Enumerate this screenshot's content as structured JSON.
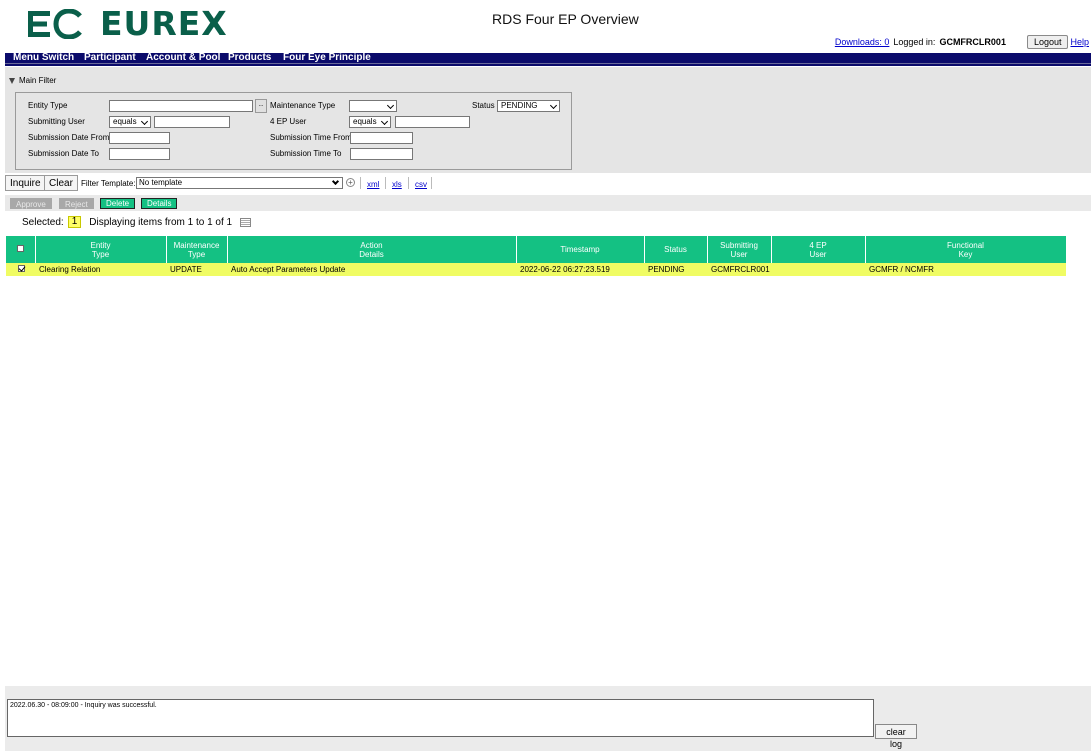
{
  "brand": {
    "logo_text": "EUREX",
    "logo_mark": "EC"
  },
  "app_title": "RDS Four EP Overview",
  "user": {
    "downloads_label": "Downloads: 0",
    "logged_in_label": "Logged in:",
    "username": "GCMFRCLR001",
    "logout_label": "Logout",
    "help_label": "Help"
  },
  "menu": [
    "Menu Switch",
    "Participant",
    "Account & Pool",
    "Products",
    "Four Eye Principle"
  ],
  "filter": {
    "section_label": "Main Filter",
    "entity_type_label": "Entity Type",
    "entity_type_value": "",
    "lookup_label": "..",
    "maintenance_type_label": "Maintenance Type",
    "maintenance_type_value": "",
    "status_label": "Status",
    "status_value": "PENDING",
    "submitting_user_label": "Submitting User",
    "submitting_user_op": "equals",
    "submitting_user_value": "",
    "four_ep_user_label": "4 EP User",
    "four_ep_user_op": "equals",
    "four_ep_user_value": "",
    "submission_date_from_label": "Submission Date From",
    "submission_date_to_label": "Submission Date To",
    "submission_time_from_label": "Submission Time From",
    "submission_time_to_label": "Submission Time To"
  },
  "toolbar": {
    "inquire_label": "Inquire",
    "clear_label": "Clear",
    "filter_template_label": "Filter Template:",
    "filter_template_value": "No template",
    "export": [
      "xml",
      "xls",
      "csv"
    ]
  },
  "actions": {
    "approve_label": "Approve",
    "reject_label": "Reject",
    "delete_label": "Delete",
    "details_label": "Details"
  },
  "selection": {
    "selected_label": "Selected:",
    "selected_count": "1",
    "displaying_label": "Displaying items from 1 to 1 of 1"
  },
  "table": {
    "columns": [
      {
        "line1": "Entity",
        "line2": "Type"
      },
      {
        "line1": "Maintenance",
        "line2": "Type"
      },
      {
        "line1": "Action",
        "line2": "Details"
      },
      {
        "line1": "Timestamp",
        "line2": ""
      },
      {
        "line1": "Status",
        "line2": ""
      },
      {
        "line1": "Submitting",
        "line2": "User"
      },
      {
        "line1": "4 EP",
        "line2": "User"
      },
      {
        "line1": "Functional",
        "line2": "Key"
      }
    ],
    "rows": [
      {
        "checked": true,
        "cells": [
          "Clearing Relation",
          "UPDATE",
          "Auto Accept Parameters Update",
          "2022-06-22 06:27:23.519",
          "PENDING",
          "GCMFRCLR001",
          "",
          "GCMFR / NCMFR"
        ]
      }
    ]
  },
  "log": {
    "message": "2022.06.30 - 08:09:00 - Inquiry was successful.",
    "clear_label": "clear log"
  },
  "colors": {
    "brand_green": "#0a5f4a",
    "menu_navy": "#0b0b6b",
    "table_header": "#14c183",
    "row_highlight": "#f0fc63"
  }
}
